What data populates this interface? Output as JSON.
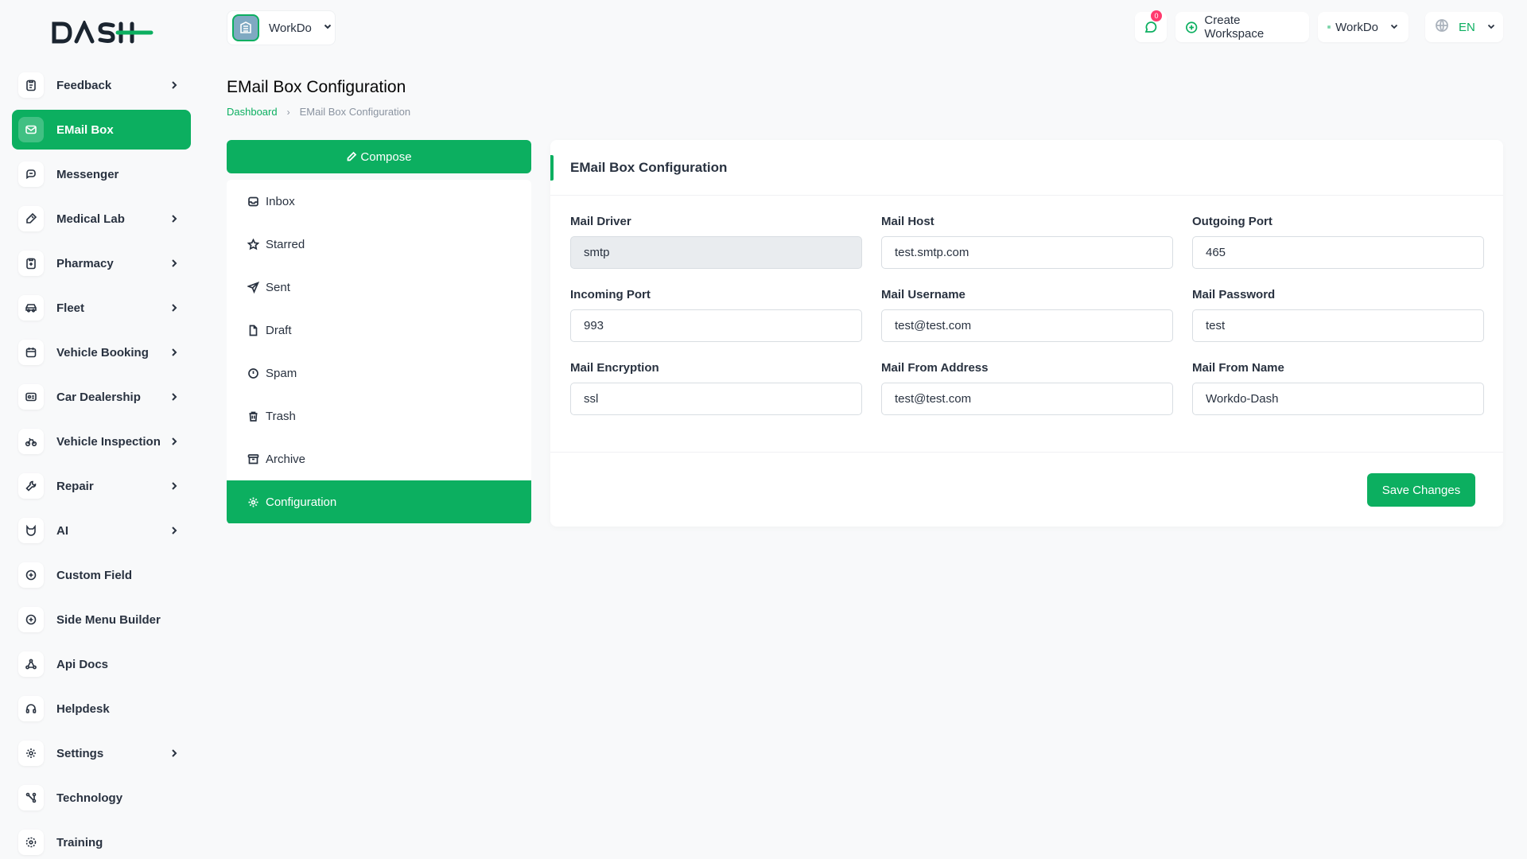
{
  "brand": {
    "logo_text": "DASH",
    "accent": "#0caf60"
  },
  "sidebar": {
    "items": [
      {
        "label": "Feedback",
        "icon": "clipboard-icon",
        "has_submenu": true
      },
      {
        "label": "EMail Box",
        "icon": "mail-icon",
        "has_submenu": false,
        "active": true
      },
      {
        "label": "Messenger",
        "icon": "chat-icon",
        "has_submenu": false
      },
      {
        "label": "Medical Lab",
        "icon": "flask-icon",
        "has_submenu": true
      },
      {
        "label": "Pharmacy",
        "icon": "clipboard-icon",
        "has_submenu": true
      },
      {
        "label": "Fleet",
        "icon": "car-icon",
        "has_submenu": true
      },
      {
        "label": "Vehicle Booking",
        "icon": "calendar-icon",
        "has_submenu": true
      },
      {
        "label": "Car Dealership",
        "icon": "id-card-icon",
        "has_submenu": true
      },
      {
        "label": "Vehicle Inspection",
        "icon": "motorbike-icon",
        "has_submenu": true
      },
      {
        "label": "Repair",
        "icon": "wrench-icon",
        "has_submenu": true
      },
      {
        "label": "AI",
        "icon": "ai-icon",
        "has_submenu": true
      },
      {
        "label": "Custom Field",
        "icon": "plus-circle-icon",
        "has_submenu": false
      },
      {
        "label": "Side Menu Builder",
        "icon": "plus-circle-icon",
        "has_submenu": false
      },
      {
        "label": "Api Docs",
        "icon": "nodes-icon",
        "has_submenu": false
      },
      {
        "label": "Helpdesk",
        "icon": "headset-icon",
        "has_submenu": false
      },
      {
        "label": "Settings",
        "icon": "gear-icon",
        "has_submenu": true
      },
      {
        "label": "Technology",
        "icon": "tech-icon",
        "has_submenu": false
      },
      {
        "label": "Training",
        "icon": "training-icon",
        "has_submenu": false
      }
    ]
  },
  "header": {
    "workspace_name": "WorkDo",
    "chat_badge": "0",
    "create_workspace": "Create Workspace",
    "workspace_menu": "WorkDo",
    "language": "EN"
  },
  "page": {
    "title": "EMail Box Configuration",
    "breadcrumb": {
      "home": "Dashboard",
      "current": "EMail Box Configuration"
    }
  },
  "mail_nav": {
    "compose": "Compose",
    "items": [
      {
        "label": "Inbox",
        "icon": "inbox-icon"
      },
      {
        "label": "Starred",
        "icon": "star-icon"
      },
      {
        "label": "Sent",
        "icon": "send-icon"
      },
      {
        "label": "Draft",
        "icon": "file-icon"
      },
      {
        "label": "Spam",
        "icon": "alert-circle-icon"
      },
      {
        "label": "Trash",
        "icon": "trash-icon"
      },
      {
        "label": "Archive",
        "icon": "archive-icon"
      },
      {
        "label": "Configuration",
        "icon": "gear-icon",
        "active": true
      }
    ]
  },
  "config": {
    "title": "EMail Box Configuration",
    "fields": [
      {
        "label": "Mail Driver",
        "value": "smtp",
        "disabled": true
      },
      {
        "label": "Mail Host",
        "value": "test.smtp.com"
      },
      {
        "label": "Outgoing Port",
        "value": "465"
      },
      {
        "label": "Incoming Port",
        "value": "993"
      },
      {
        "label": "Mail Username",
        "value": "test@test.com"
      },
      {
        "label": "Mail Password",
        "value": "test"
      },
      {
        "label": "Mail Encryption",
        "value": "ssl"
      },
      {
        "label": "Mail From Address",
        "value": "test@test.com"
      },
      {
        "label": "Mail From Name",
        "value": "Workdo-Dash"
      }
    ],
    "save": "Save Changes"
  }
}
